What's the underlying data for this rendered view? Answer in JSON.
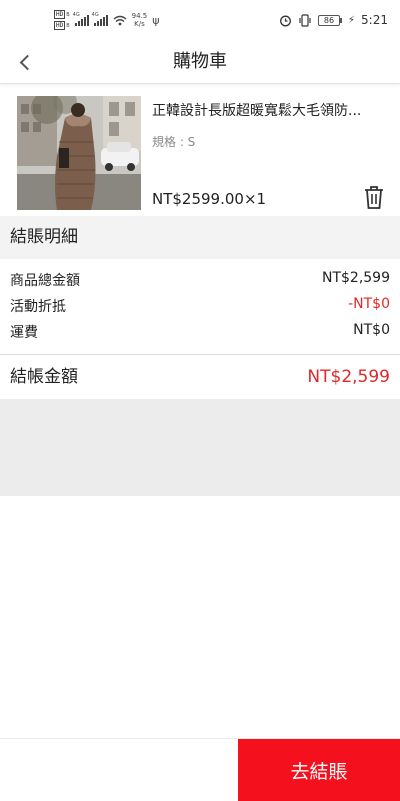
{
  "status_bar": {
    "sim1": "HD",
    "sim2": "HD",
    "sim_suffix": "B",
    "network1": "4G",
    "network2": "4G",
    "speed_value": "94.5",
    "speed_unit": "K/s",
    "battery": "86",
    "time": "5:21"
  },
  "header": {
    "title": "購物車"
  },
  "product": {
    "name": "正韓設計長版超暖寬鬆大毛領防...",
    "spec": "規格 : S",
    "price": "NT$2599.00×1"
  },
  "summary": {
    "section_title": "結賬明細",
    "rows": [
      {
        "label": "商品總金額",
        "value": "NT$2,599"
      },
      {
        "label": "活動折抵",
        "value": "-NT$0"
      },
      {
        "label": "運費",
        "value": "NT$0"
      }
    ],
    "total_label": "結帳金額",
    "total_value": "NT$2,599"
  },
  "footer": {
    "checkout_label": "去結賬"
  },
  "colors": {
    "accent_red": "#f5101e",
    "price_red": "#e02828"
  }
}
